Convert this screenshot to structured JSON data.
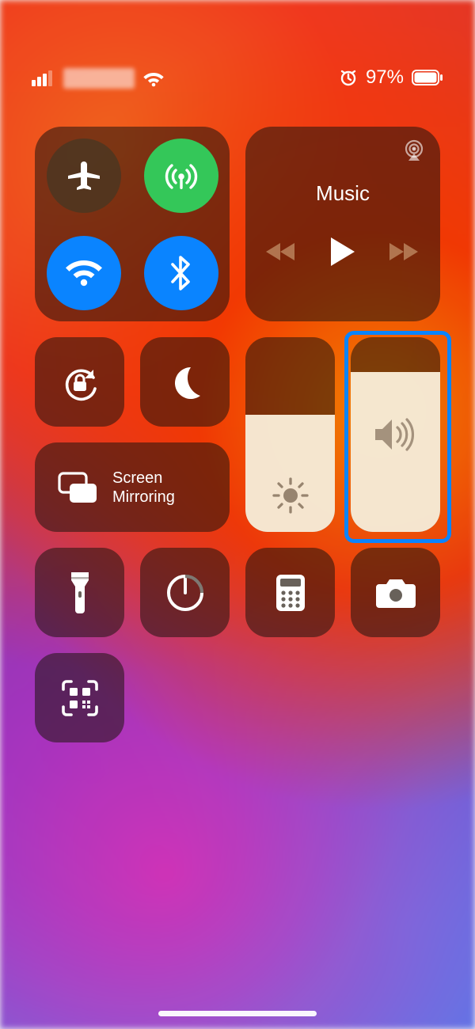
{
  "status": {
    "battery_percent": "97%",
    "alarm_set": true
  },
  "connectivity": {
    "airplane_mode": {
      "on": false,
      "icon": "airplane-icon",
      "color_on": "#ff9500",
      "color_off": "rgba(70,55,35,0.75)"
    },
    "cellular": {
      "on": true,
      "icon": "cellular-antenna-icon",
      "color_on": "#34c759"
    },
    "wifi": {
      "on": true,
      "icon": "wifi-icon",
      "color_on": "#0a84ff"
    },
    "bluetooth": {
      "on": true,
      "icon": "bluetooth-icon",
      "color_on": "#0a84ff"
    }
  },
  "media": {
    "title": "Music",
    "airplay_icon": "airplay-icon",
    "controls": {
      "prev": "rewind-icon",
      "play": "play-icon",
      "next": "forward-icon"
    }
  },
  "toggles": {
    "orientation_lock": {
      "icon": "orientation-lock-icon"
    },
    "do_not_disturb": {
      "icon": "moon-icon"
    }
  },
  "screen_mirroring": {
    "icon": "screen-mirroring-icon",
    "label_line1": "Screen",
    "label_line2": "Mirroring"
  },
  "sliders": {
    "brightness": {
      "level_percent": 60,
      "icon": "sun-icon"
    },
    "volume": {
      "level_percent": 82,
      "icon": "speaker-icon",
      "highlighted": true,
      "highlight_color": "#0a84ff"
    }
  },
  "quick_actions": [
    {
      "id": "flashlight",
      "icon": "flashlight-icon"
    },
    {
      "id": "timer",
      "icon": "timer-icon"
    },
    {
      "id": "calculator",
      "icon": "calculator-icon"
    },
    {
      "id": "camera",
      "icon": "camera-icon"
    },
    {
      "id": "qr_scanner",
      "icon": "qr-code-icon"
    }
  ]
}
